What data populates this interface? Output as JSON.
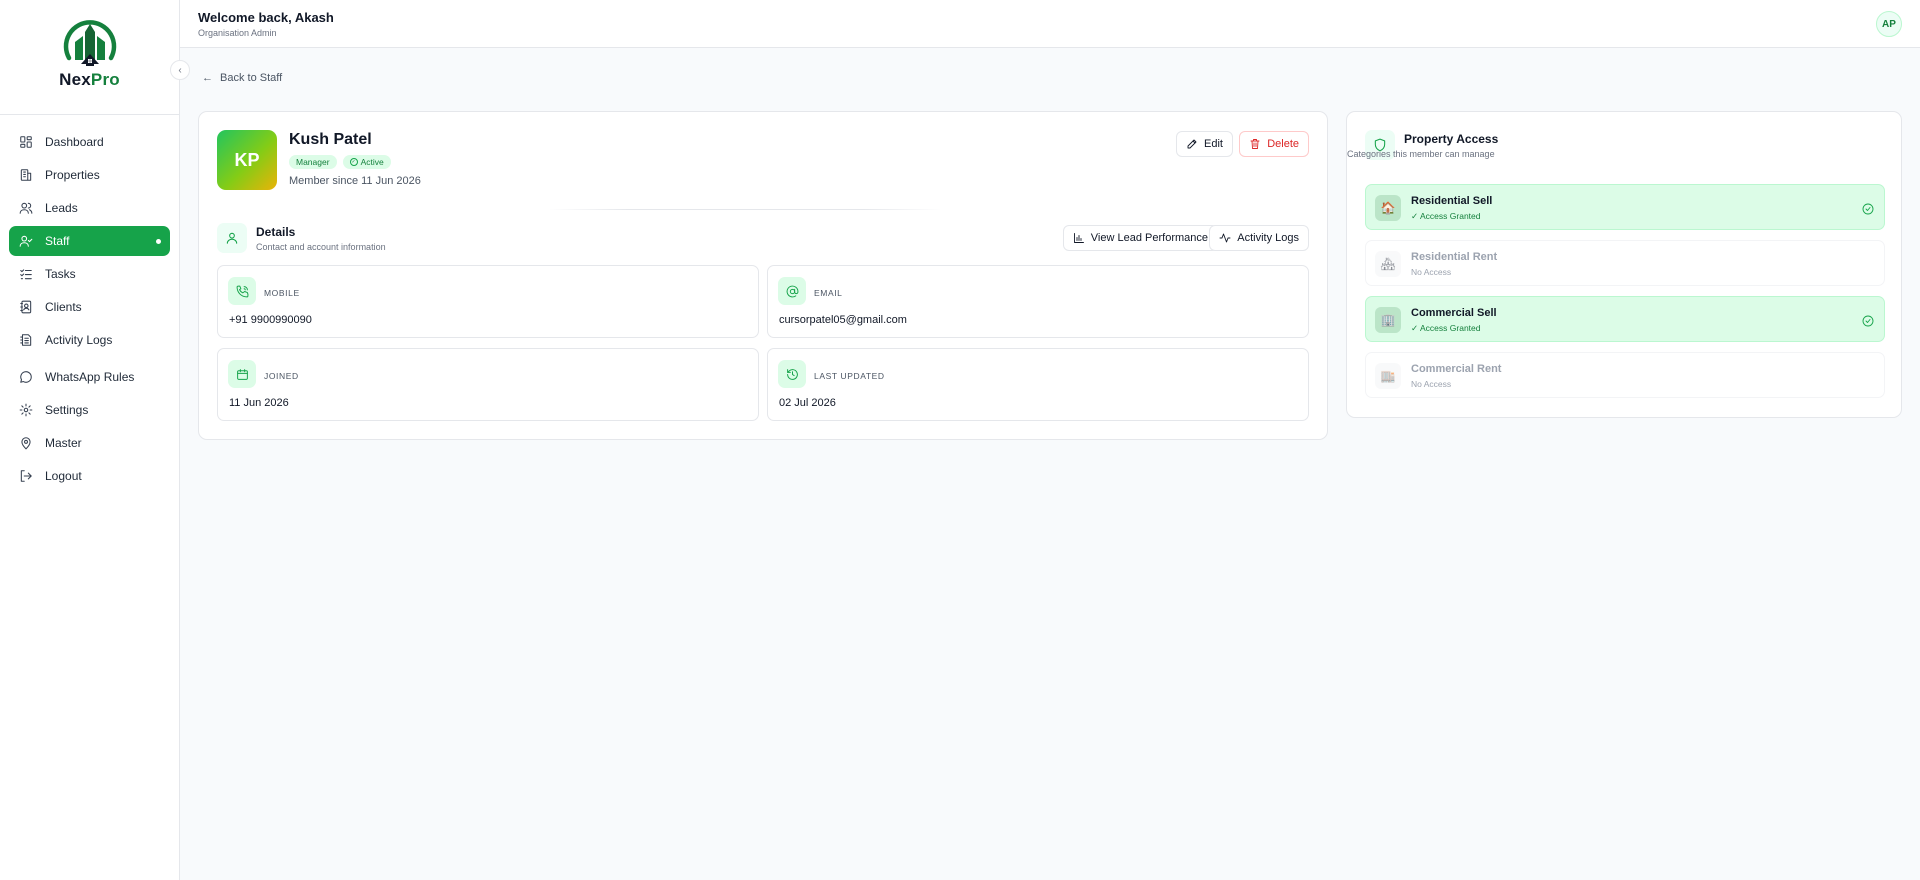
{
  "brand": {
    "name_part1": "Nex",
    "name_part2": "Pro",
    "accent": "#16a34a"
  },
  "sidebar": {
    "items": [
      {
        "label": "Dashboard",
        "icon": "dashboard-icon"
      },
      {
        "label": "Properties",
        "icon": "building-icon"
      },
      {
        "label": "Leads",
        "icon": "users-icon"
      },
      {
        "label": "Staff",
        "icon": "user-check-icon",
        "active": true
      },
      {
        "label": "Tasks",
        "icon": "list-checks-icon"
      },
      {
        "label": "Clients",
        "icon": "contact-book-icon"
      },
      {
        "label": "Activity Logs",
        "icon": "logs-icon"
      },
      {
        "label": "WhatsApp Rules",
        "icon": "message-circle-icon"
      },
      {
        "label": "Settings",
        "icon": "gear-icon"
      },
      {
        "label": "Master",
        "icon": "map-pin-icon"
      },
      {
        "label": "Logout",
        "icon": "logout-icon"
      }
    ]
  },
  "header": {
    "welcome": "Welcome back, Akash",
    "role": "Organisation Admin",
    "avatar_initials": "AP"
  },
  "back_link": "Back to Staff",
  "profile": {
    "initials": "KP",
    "name": "Kush Patel",
    "role_badge": "Manager",
    "status_badge": "Active",
    "member_since": "Member since 11 Jun 2026",
    "edit_label": "Edit",
    "delete_label": "Delete"
  },
  "details": {
    "title": "Details",
    "subtitle": "Contact and account information",
    "perf_label": "View Lead Performance",
    "logs_label": "Activity Logs",
    "fields": [
      {
        "label": "MOBILE",
        "value": "+91 9900990090",
        "icon": "phone-icon"
      },
      {
        "label": "EMAIL",
        "value": "cursorpatel05@gmail.com",
        "icon": "at-sign-icon"
      },
      {
        "label": "JOINED",
        "value": "11 Jun 2026",
        "icon": "calendar-icon"
      },
      {
        "label": "LAST UPDATED",
        "value": "02 Jul 2026",
        "icon": "history-icon"
      }
    ]
  },
  "access": {
    "title": "Property Access",
    "subtitle": "Categories this member can manage",
    "rows": [
      {
        "name": "Residential Sell",
        "status": "✓ Access Granted",
        "granted": true,
        "icon": "house-icon"
      },
      {
        "name": "Residential Rent",
        "status": "No Access",
        "granted": false,
        "icon": "house-icon"
      },
      {
        "name": "Commercial Sell",
        "status": "✓ Access Granted",
        "granted": true,
        "icon": "office-building-icon"
      },
      {
        "name": "Commercial Rent",
        "status": "No Access",
        "granted": false,
        "icon": "office-building-icon"
      }
    ]
  }
}
